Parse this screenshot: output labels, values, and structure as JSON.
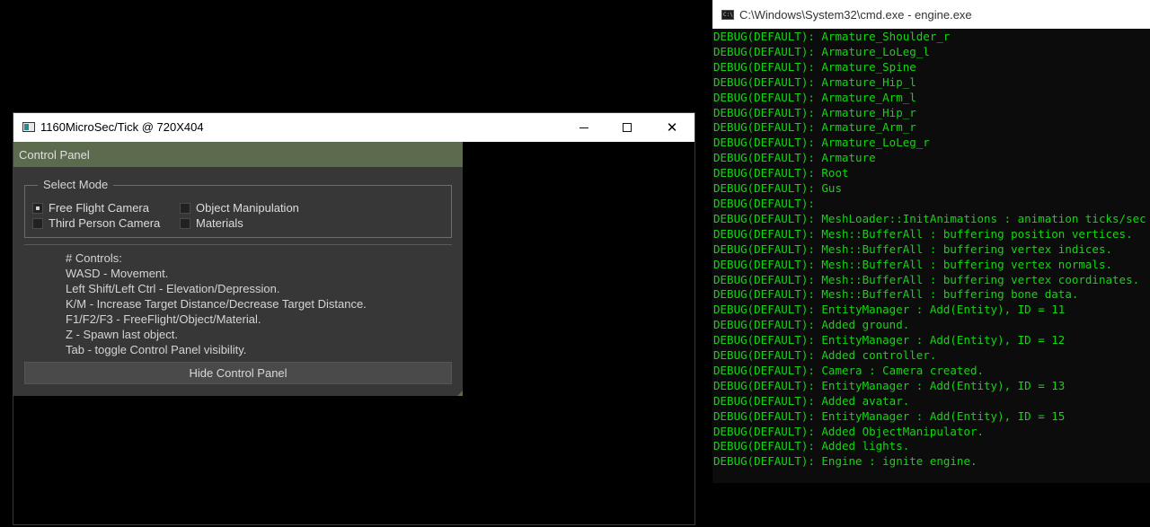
{
  "engine_window": {
    "title": "1160MicroSec/Tick @ 720X404",
    "minimize_glyph": "",
    "maximize_glyph": "",
    "close_glyph": "✕"
  },
  "control_panel": {
    "header": "Control Panel",
    "select_mode": {
      "legend": "Select Mode",
      "options": [
        {
          "label": "Free Flight Camera",
          "checked": true
        },
        {
          "label": "Object Manipulation",
          "checked": false
        },
        {
          "label": "Third Person Camera",
          "checked": false
        },
        {
          "label": "Materials",
          "checked": false
        }
      ]
    },
    "controls_lines": [
      "# Controls:",
      "WASD - Movement.",
      "Left Shift/Left Ctrl - Elevation/Depression.",
      "K/M - Increase Target Distance/Decrease Target Distance.",
      "F1/F2/F3 - FreeFlight/Object/Material.",
      "Z - Spawn last object.",
      "Tab - toggle Control Panel visibility."
    ],
    "hide_button": "Hide Control Panel"
  },
  "cmd_window": {
    "icon_text": "C:\\",
    "title": "C:\\Windows\\System32\\cmd.exe - engine.exe",
    "lines": [
      "DEBUG(DEFAULT): Armature_Shoulder_r",
      "DEBUG(DEFAULT): Armature_LoLeg_l",
      "DEBUG(DEFAULT): Armature_Spine",
      "DEBUG(DEFAULT): Armature_Hip_l",
      "DEBUG(DEFAULT): Armature_Arm_l",
      "DEBUG(DEFAULT): Armature_Hip_r",
      "DEBUG(DEFAULT): Armature_Arm_r",
      "DEBUG(DEFAULT): Armature_LoLeg_r",
      "DEBUG(DEFAULT): Armature",
      "DEBUG(DEFAULT): Root",
      "DEBUG(DEFAULT): Gus",
      "DEBUG(DEFAULT):",
      "DEBUG(DEFAULT): MeshLoader::InitAnimations : animation ticks/sec",
      "DEBUG(DEFAULT): Mesh::BufferAll : buffering position vertices.",
      "DEBUG(DEFAULT): Mesh::BufferAll : buffering vertex indices.",
      "DEBUG(DEFAULT): Mesh::BufferAll : buffering vertex normals.",
      "DEBUG(DEFAULT): Mesh::BufferAll : buffering vertex coordinates.",
      "DEBUG(DEFAULT): Mesh::BufferAll : buffering bone data.",
      "DEBUG(DEFAULT): EntityManager : Add(Entity), ID = 11",
      "DEBUG(DEFAULT): Added ground.",
      "DEBUG(DEFAULT): EntityManager : Add(Entity), ID = 12",
      "DEBUG(DEFAULT): Added controller.",
      "DEBUG(DEFAULT): Camera : Camera created.",
      "DEBUG(DEFAULT): EntityManager : Add(Entity), ID = 13",
      "DEBUG(DEFAULT): Added avatar.",
      "DEBUG(DEFAULT): EntityManager : Add(Entity), ID = 15",
      "DEBUG(DEFAULT): Added ObjectManipulator.",
      "DEBUG(DEFAULT): Added lights.",
      "DEBUG(DEFAULT): Engine : ignite engine."
    ]
  },
  "colors": {
    "console_text": "#13d613",
    "panel_header": "#5c6b4e",
    "panel_bg": "#373737"
  }
}
